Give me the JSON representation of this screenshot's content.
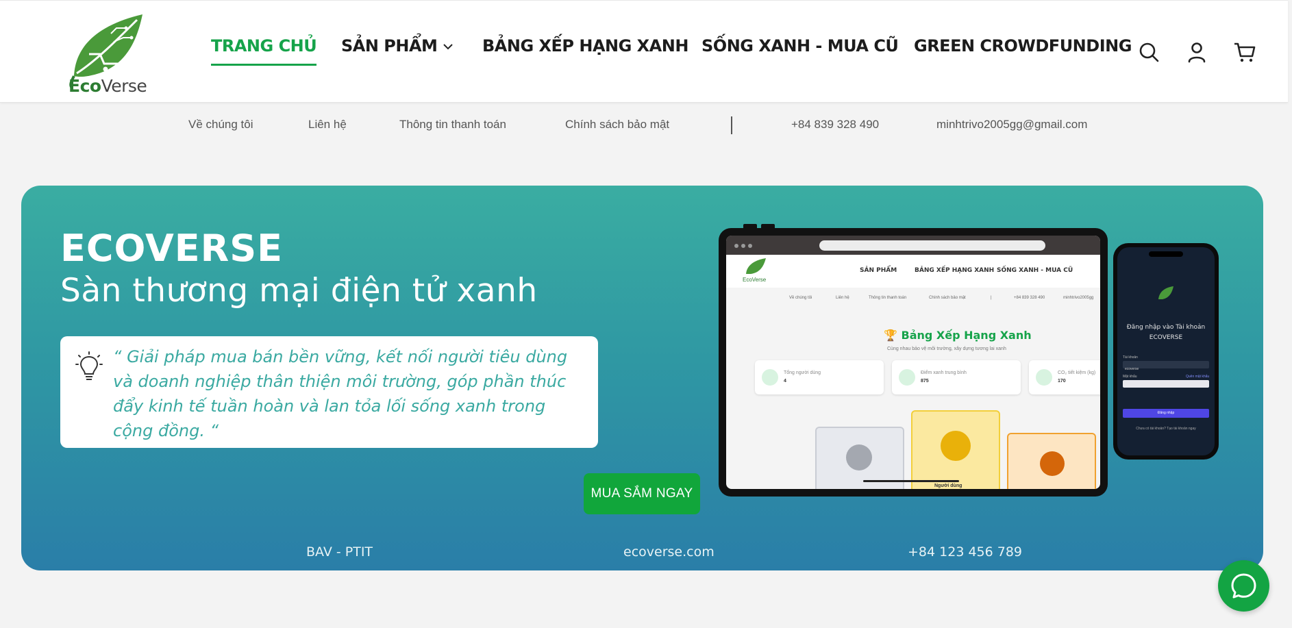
{
  "brand": {
    "name_part1": "Eco",
    "name_part2": "Verse",
    "leaf_color": "#4a9a3a"
  },
  "nav": {
    "items": [
      {
        "label": "TRANG CHỦ",
        "active": true
      },
      {
        "label": "SẢN PHẨM",
        "has_dropdown": true
      },
      {
        "label": "BẢNG XẾP HẠNG XANH"
      },
      {
        "label": "SỐNG XANH - MUA CŨ"
      },
      {
        "label": "GREEN CROWDFUNDING"
      }
    ],
    "icons": [
      "search-icon",
      "user-icon",
      "cart-icon"
    ]
  },
  "toplinks": {
    "about": "Về chúng tôi",
    "contact": "Liên hệ",
    "payment": "Thông tin thanh toán",
    "privacy": "Chính sách bảo mật",
    "phone": "+84 839 328 490",
    "email": "minhtrivo2005gg@gmail.com"
  },
  "hero": {
    "title": "ECOVERSE",
    "subtitle": "Sàn thương mại điện tử xanh",
    "quote": "“ Giải pháp mua bán bền vững, kết nối người tiêu dùng và doanh nghiệp thân thiện môi trường, góp phần thúc đẩy kinh tế tuần hoàn và lan tỏa lối sống xanh trong cộng đồng. “",
    "cta": "MUA SẮM NGAY",
    "footer": {
      "org": "BAV - PTIT",
      "site": "ecoverse.com",
      "phone": "+84 123 456 789"
    }
  },
  "mockup_tablet": {
    "nav": [
      "SẢN PHẨM",
      "BẢNG XẾP HẠNG XANH",
      "SỐNG XANH - MUA CŨ"
    ],
    "links": [
      "Về chúng tôi",
      "Liên hệ",
      "Thông tin thanh toán",
      "Chính sách bảo mật",
      "|",
      "+84 839 328 490",
      "minhtrivo2005gg"
    ],
    "brand": "EcoVerse",
    "title": "Bảng Xếp Hạng Xanh",
    "subtitle": "Cùng nhau bảo vệ môi trường, xây dựng tương lai xanh",
    "cards": [
      {
        "label": "Tổng người dùng",
        "value": "4"
      },
      {
        "label": "Điểm xanh trung bình",
        "value": "875"
      },
      {
        "label": "CO₂ tiết kiệm (kg)",
        "value": "170"
      }
    ],
    "podium_label": "Người dùng"
  },
  "mockup_phone": {
    "title_line1": "Đăng nhập vào Tài khoản",
    "title_line2": "ECOVERSE",
    "username_label": "Tài khoản",
    "username_value": "ecoverse",
    "password_label": "Mật khẩu",
    "forgot": "Quên mật khẩu",
    "login": "Đăng nhập",
    "footer": "Chưa có tài khoản? Tạo tài khoản ngay"
  },
  "colors": {
    "accent": "#16a34a",
    "cta": "#11a63b",
    "hero_top": "#3aada2",
    "hero_bottom": "#2a7ea8"
  }
}
